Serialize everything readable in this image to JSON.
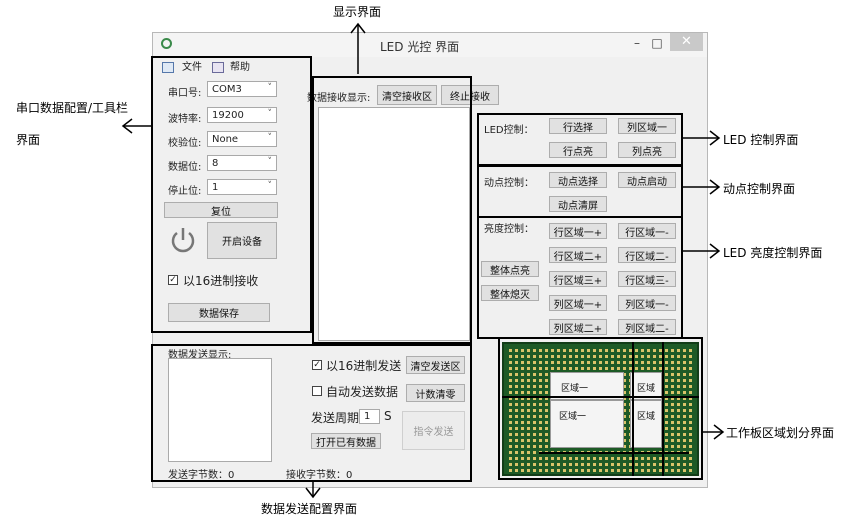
{
  "annotations": {
    "display": "显示界面",
    "serial": "串口数据配置/工具栏",
    "serial2": "界面",
    "led_ctrl": "LED 控制界面",
    "dot_ctrl": "动点控制界面",
    "brightness": "LED 亮度控制界面",
    "board": "工作板区域划分界面",
    "send": "数据发送配置界面"
  },
  "window": {
    "title": "LED 光控 界面",
    "minimize": "–",
    "maximize": "□",
    "close": "✕"
  },
  "menu": {
    "file": "文件",
    "help": "帮助"
  },
  "serial": {
    "port_label": "串口号:",
    "port_value": "COM3",
    "baud_label": "波特率:",
    "baud_value": "19200",
    "parity_label": "校验位:",
    "parity_value": "None",
    "data_label": "数据位:",
    "data_value": "8",
    "stop_label": "停止位:",
    "stop_value": "1",
    "reset": "复位",
    "open_device": "开启设备",
    "hex_receive": "以16进制接收",
    "save_data": "数据保存"
  },
  "receive": {
    "label": "数据接收显示:",
    "clear": "清空接收区",
    "stop": "终止接收"
  },
  "send": {
    "label": "数据发送显示:",
    "hex_send": "以16进制发送",
    "auto_send": "自动发送数据",
    "period_label": "发送周期",
    "period_value": "1",
    "period_unit": "S",
    "open_data": "打开已有数据",
    "clear_send": "清空发送区",
    "count_clear": "计数清零",
    "cmd_send": "指令发送",
    "sent_bytes": "发送字节数：0",
    "recv_bytes": "接收字节数：0"
  },
  "led": {
    "label": "LED控制：",
    "row_select": "行选择",
    "col_zone1": "列区域一",
    "row_on": "行点亮",
    "col_on": "列点亮"
  },
  "dot": {
    "label": "动点控制：",
    "select": "动点选择",
    "start": "动点启动",
    "clear": "动点清屏"
  },
  "bright": {
    "label": "亮度控制：",
    "all_on": "整体点亮",
    "all_off": "整体熄灭",
    "row1_plus": "行区域一+",
    "row1_minus": "行区域一-",
    "row2_plus": "行区域二+",
    "row2_minus": "行区域二-",
    "row3_plus": "行区域三+",
    "row3_minus": "行区域三-",
    "col1_plus": "列区域一+",
    "col1_minus": "列区域一-",
    "col2_plus": "列区域二+",
    "col2_minus": "列区域二-"
  },
  "board": {
    "zone1": "区域一",
    "zone2": "区域一",
    "zone3": "区域",
    "zone4": "区域"
  },
  "colors": {
    "board_green": "#1d5a26",
    "annotation_border": "#000000"
  }
}
